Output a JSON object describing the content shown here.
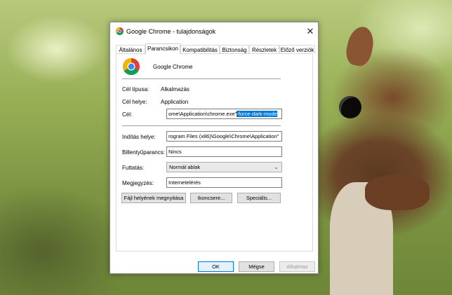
{
  "dialog": {
    "title": "Google Chrome - tulajdonságok",
    "close_glyph": "✕"
  },
  "tabs": [
    {
      "label": "Általános"
    },
    {
      "label": "Parancsikon"
    },
    {
      "label": "Kompatibilitás"
    },
    {
      "label": "Biztonság"
    },
    {
      "label": "Részletek"
    },
    {
      "label": "Előző verziók"
    }
  ],
  "active_tab": "Parancsikon",
  "app": {
    "name": "Google Chrome",
    "icon": "chrome-logo-icon"
  },
  "info": {
    "type_label": "Cél típusa:",
    "type_value": "Alkalmazás",
    "location_label": "Cél helye:",
    "location_value": "Application"
  },
  "target": {
    "label": "Cél:",
    "value_plain": "ome\\Application\\chrome.exe\"",
    "value_selected": "-force-dark-mode"
  },
  "start_in": {
    "label": "Indítás helye:",
    "value": "rogram Files (x86)\\Google\\Chrome\\Application\""
  },
  "hotkey": {
    "label": "Billentyűparancs:",
    "value": "Nincs"
  },
  "run": {
    "label": "Futtatás:",
    "value": "Normál ablak"
  },
  "comment": {
    "label": "Megjegyzés:",
    "value": "Internetelérés"
  },
  "actions": {
    "open_location": "Fájl helyének megnyitása",
    "change_icon": "Ikoncsere...",
    "advanced": "Speciális..."
  },
  "footer": {
    "ok": "OK",
    "cancel": "Mégse",
    "apply": "Alkalmaz"
  },
  "colors": {
    "selection": "#0078d7",
    "ok_border": "#0078d7"
  }
}
